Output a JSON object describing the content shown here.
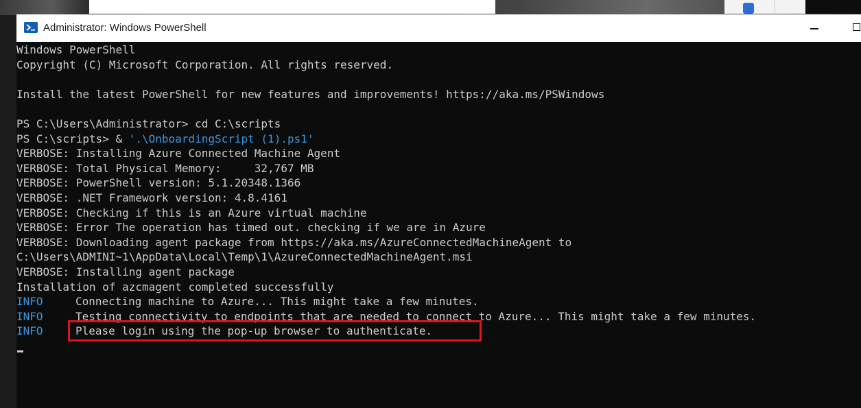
{
  "window": {
    "title": "Administrator: Windows PowerShell",
    "icon": "powershell-icon"
  },
  "console": {
    "lines": [
      {
        "text": "Windows PowerShell"
      },
      {
        "text": "Copyright (C) Microsoft Corporation. All rights reserved."
      },
      {
        "text": ""
      },
      {
        "text": "Install the latest PowerShell for new features and improvements! https://aka.ms/PSWindows"
      },
      {
        "text": ""
      },
      {
        "text": "PS C:\\Users\\Administrator> cd C:\\scripts"
      },
      {
        "prompt": "PS C:\\scripts> & ",
        "string": "'.\\OnboardingScript (1).ps1'"
      },
      {
        "text": "VERBOSE: Installing Azure Connected Machine Agent"
      },
      {
        "text": "VERBOSE: Total Physical Memory:     32,767 MB"
      },
      {
        "text": "VERBOSE: PowerShell version: 5.1.20348.1366"
      },
      {
        "text": "VERBOSE: .NET Framework version: 4.8.4161"
      },
      {
        "text": "VERBOSE: Checking if this is an Azure virtual machine"
      },
      {
        "text": "VERBOSE: Error The operation has timed out. checking if we are in Azure"
      },
      {
        "text": "VERBOSE: Downloading agent package from https://aka.ms/AzureConnectedMachineAgent to"
      },
      {
        "text": "C:\\Users\\ADMINI~1\\AppData\\Local\\Temp\\1\\AzureConnectedMachineAgent.msi"
      },
      {
        "text": "VERBOSE: Installing agent package"
      },
      {
        "text": "Installation of azcmagent completed successfully"
      },
      {
        "tag": "INFO",
        "message": "Connecting machine to Azure... This might take a few minutes."
      },
      {
        "tag": "INFO",
        "message": "Testing connectivity to endpoints that are needed to connect to Azure... This might take a few minutes."
      },
      {
        "tag": "INFO",
        "message": "Please login using the pop-up browser to authenticate."
      }
    ]
  },
  "colors": {
    "console_bg": "#0c0c0c",
    "console_fg": "#cccccc",
    "string_blue": "#3a96dd",
    "highlight_red": "#e0141e"
  }
}
